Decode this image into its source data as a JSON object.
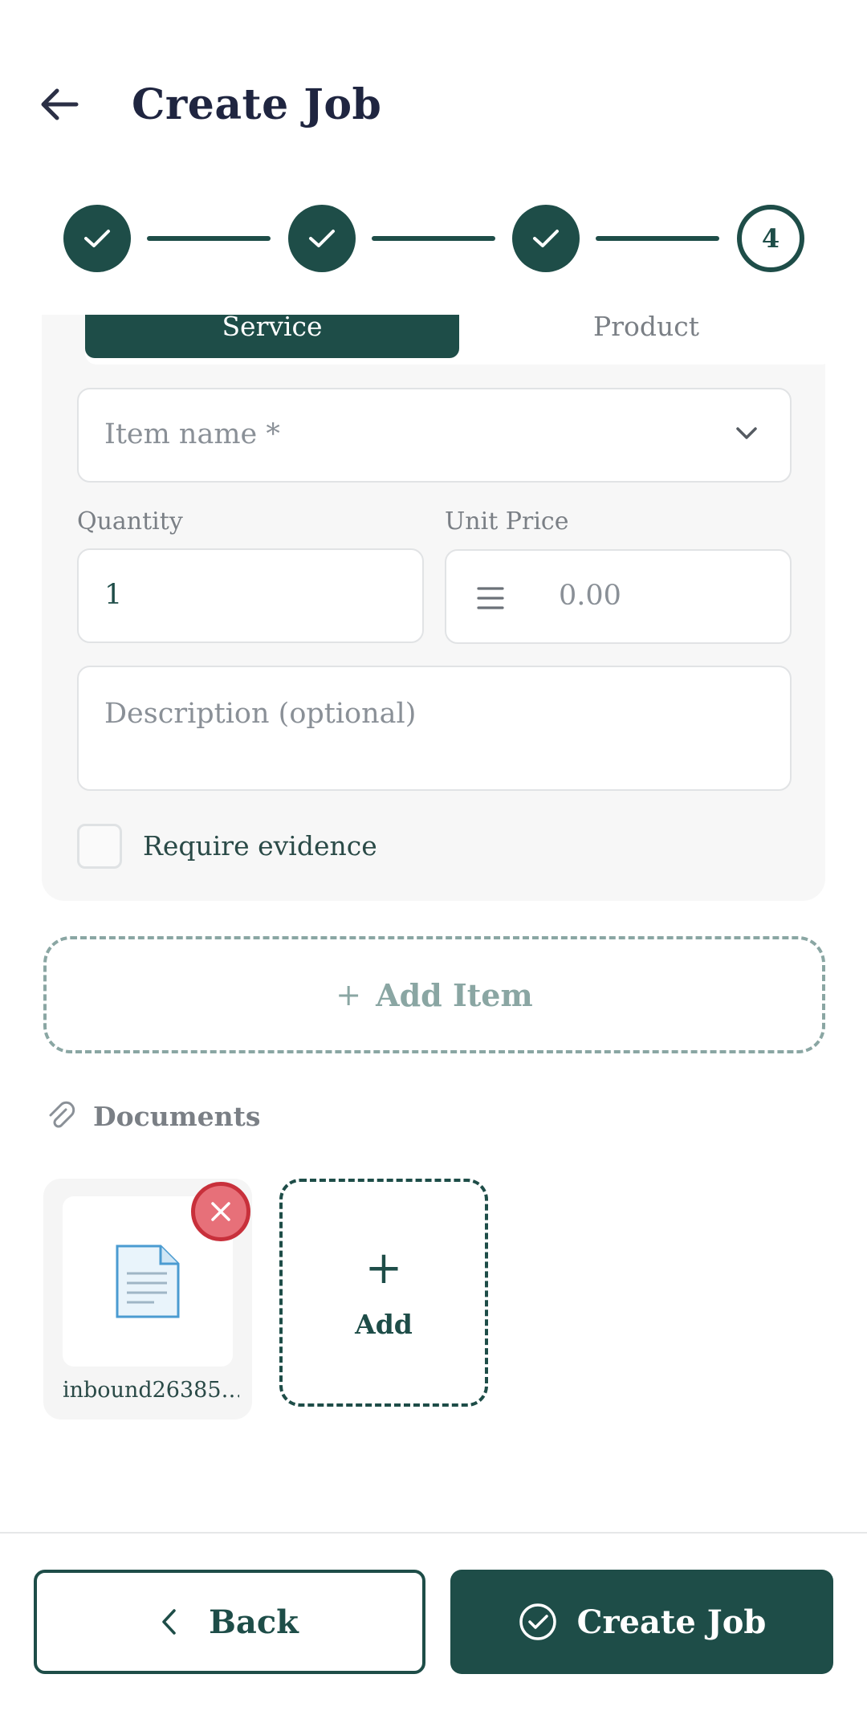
{
  "header": {
    "title": "Create Job"
  },
  "stepper": {
    "current_step": "4"
  },
  "item": {
    "type_options": [
      "Service",
      "Product"
    ],
    "item_name_placeholder": "Item name *",
    "quantity_label": "Quantity",
    "quantity_value": "1",
    "unit_price_label": "Unit Price",
    "unit_price_placeholder": "0.00",
    "description_placeholder": "Description (optional)",
    "require_evidence_label": "Require evidence"
  },
  "add_item": {
    "plus": "+",
    "label": "Add Item"
  },
  "documents": {
    "title": "Documents",
    "files": [
      {
        "name": "inbound26385…"
      }
    ],
    "add_plus": "+",
    "add_label": "Add"
  },
  "footer": {
    "back_label": "Back",
    "create_label": "Create Job"
  },
  "colors": {
    "primary": "#1e4d48",
    "remove": "#e77079",
    "dashed": "#8aa6a3"
  }
}
